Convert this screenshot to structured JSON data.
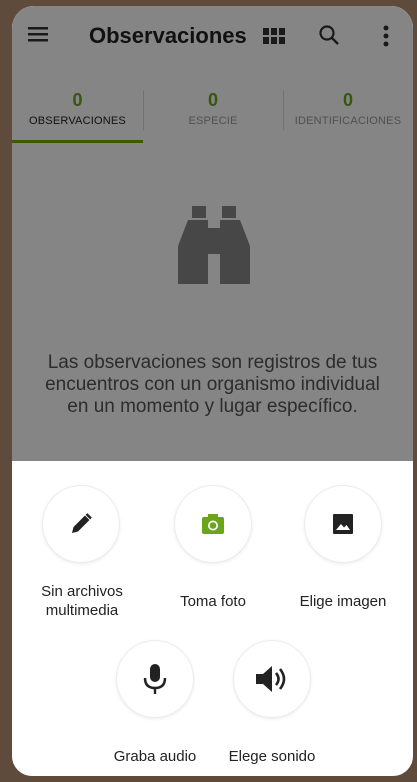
{
  "toolbar": {
    "title": "Observaciones",
    "menu_icon": "hamburger-menu-icon",
    "grid_icon": "grid-view-icon",
    "search_icon": "search-icon",
    "more_icon": "more-vert-icon"
  },
  "tabs": [
    {
      "count": "0",
      "label": "OBSERVACIONES",
      "active": true
    },
    {
      "count": "0",
      "label": "ESPECIE",
      "active": false
    },
    {
      "count": "0",
      "label": "IDENTIFICACIONES",
      "active": false
    }
  ],
  "empty_state": {
    "icon": "binoculars-icon",
    "text": "Las observaciones son registros de tus encuentros con un organismo individual en un momento y lugar específico."
  },
  "sheet": {
    "options": [
      {
        "label": "Sin archivos multimedia",
        "icon": "pencil-icon"
      },
      {
        "label": "Toma foto",
        "icon": "camera-icon"
      },
      {
        "label": "Elige imagen",
        "icon": "image-icon"
      },
      {
        "label": "Graba audio",
        "icon": "microphone-icon"
      },
      {
        "label": "Elege sonido",
        "icon": "speaker-icon"
      }
    ]
  },
  "colors": {
    "accent": "#74ac00",
    "count_green": "#6aa51c",
    "frame": "#5e4b3b"
  }
}
